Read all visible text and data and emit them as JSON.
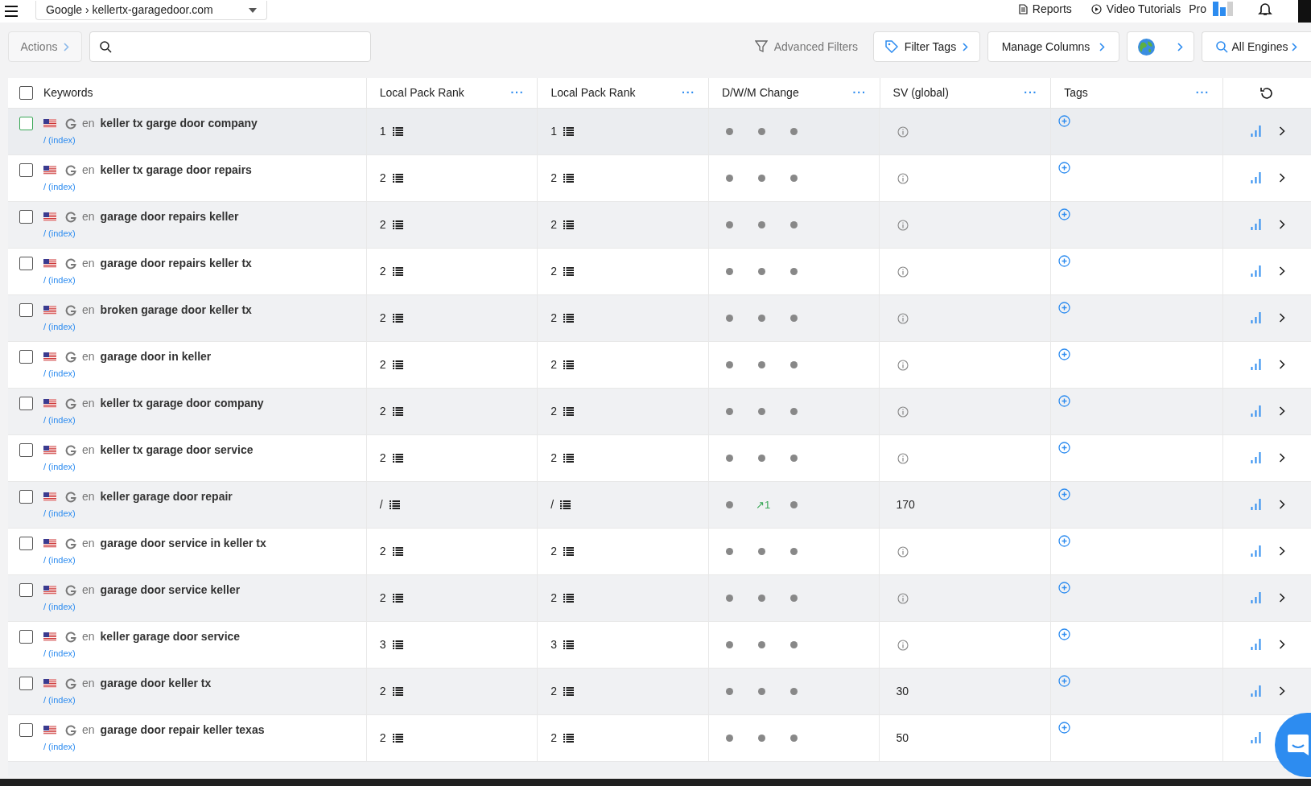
{
  "topbar": {
    "project": "Google › kellertx-garagedoor.com",
    "links": [
      "Reports",
      "Video Tutorials"
    ],
    "plan": "Pro"
  },
  "toolbar": {
    "actions": "Actions",
    "advanced_filters": "Advanced Filters",
    "filter_tags": "Filter Tags",
    "manage_columns": "Manage Columns",
    "engines": "All Engines"
  },
  "table": {
    "select_all_checked": false,
    "columns": [
      {
        "label": "Keywords"
      },
      {
        "label": "Local Pack Rank",
        "menu": "···"
      },
      {
        "label": "Local Pack Rank",
        "menu": "···"
      },
      {
        "label": "D/W/M Change",
        "menu": "···"
      },
      {
        "label": "SV (global)",
        "menu": "···"
      },
      {
        "label": "Tags",
        "menu": "···"
      }
    ],
    "rows": [
      {
        "checked": false,
        "focused": true,
        "lang": "en",
        "keyword": "keller tx garge door company",
        "url": "/ (index)",
        "rank_1": "1",
        "rank_2": "1",
        "changes": [
          {
            "kind": "none"
          },
          {
            "kind": "none"
          },
          {
            "kind": "none"
          }
        ]
      },
      {
        "checked": false,
        "focused": false,
        "lang": "en",
        "keyword": "keller tx garage door repairs",
        "url": "/ (index)",
        "rank_1": "2",
        "rank_2": "2",
        "changes": [
          {
            "kind": "none"
          },
          {
            "kind": "none"
          },
          {
            "kind": "none"
          }
        ]
      },
      {
        "checked": false,
        "focused": false,
        "lang": "en",
        "keyword": "garage door repairs keller",
        "url": "/ (index)",
        "rank_1": "2",
        "rank_2": "2",
        "changes": [
          {
            "kind": "none"
          },
          {
            "kind": "none"
          },
          {
            "kind": "none"
          }
        ]
      },
      {
        "checked": false,
        "focused": false,
        "lang": "en",
        "keyword": "garage door repairs keller tx",
        "url": "/ (index)",
        "rank_1": "2",
        "rank_2": "2",
        "changes": [
          {
            "kind": "none"
          },
          {
            "kind": "none"
          },
          {
            "kind": "none"
          }
        ]
      },
      {
        "checked": false,
        "focused": false,
        "lang": "en",
        "keyword": "broken garage door keller tx",
        "url": "/ (index)",
        "rank_1": "2",
        "rank_2": "2",
        "changes": [
          {
            "kind": "none"
          },
          {
            "kind": "none"
          },
          {
            "kind": "none"
          }
        ]
      },
      {
        "checked": false,
        "focused": false,
        "lang": "en",
        "keyword": "garage door in keller",
        "url": "/ (index)",
        "rank_1": "2",
        "rank_2": "2",
        "changes": [
          {
            "kind": "none"
          },
          {
            "kind": "none"
          },
          {
            "kind": "none"
          }
        ]
      },
      {
        "checked": false,
        "focused": false,
        "lang": "en",
        "keyword": "keller tx garage door company",
        "url": "/ (index)",
        "rank_1": "2",
        "rank_2": "2",
        "changes": [
          {
            "kind": "none"
          },
          {
            "kind": "none"
          },
          {
            "kind": "none"
          }
        ]
      },
      {
        "checked": false,
        "focused": false,
        "lang": "en",
        "keyword": "keller tx garage door service",
        "url": "/ (index)",
        "rank_1": "2",
        "rank_2": "2",
        "changes": [
          {
            "kind": "none"
          },
          {
            "kind": "none"
          },
          {
            "kind": "none"
          }
        ]
      },
      {
        "checked": false,
        "focused": false,
        "lang": "en",
        "keyword": "keller garage door repair",
        "url": "/ (index)",
        "rank_1": "/",
        "rank_2": "/",
        "changes": [
          {
            "kind": "none"
          },
          {
            "kind": "up",
            "value": "↗1"
          },
          {
            "kind": "none"
          }
        ],
        "sv": "170"
      },
      {
        "checked": false,
        "focused": false,
        "lang": "en",
        "keyword": "garage door service in keller tx",
        "url": "/ (index)",
        "rank_1": "2",
        "rank_2": "2",
        "changes": [
          {
            "kind": "none"
          },
          {
            "kind": "none"
          },
          {
            "kind": "none"
          }
        ]
      },
      {
        "checked": false,
        "focused": false,
        "lang": "en",
        "keyword": "garage door service keller",
        "url": "/ (index)",
        "rank_1": "2",
        "rank_2": "2",
        "changes": [
          {
            "kind": "none"
          },
          {
            "kind": "none"
          },
          {
            "kind": "none"
          }
        ]
      },
      {
        "checked": false,
        "focused": false,
        "lang": "en",
        "keyword": "keller garage door service",
        "url": "/ (index)",
        "rank_1": "3",
        "rank_2": "3",
        "changes": [
          {
            "kind": "none"
          },
          {
            "kind": "none"
          },
          {
            "kind": "none"
          }
        ]
      },
      {
        "checked": false,
        "focused": false,
        "lang": "en",
        "keyword": "garage door keller tx",
        "url": "/ (index)",
        "rank_1": "2",
        "rank_2": "2",
        "changes": [
          {
            "kind": "none"
          },
          {
            "kind": "none"
          },
          {
            "kind": "none"
          }
        ],
        "sv": "30"
      },
      {
        "checked": false,
        "focused": false,
        "lang": "en",
        "keyword": "garage door repair keller texas",
        "url": "/ (index)",
        "rank_1": "2",
        "rank_2": "2",
        "changes": [
          {
            "kind": "none"
          },
          {
            "kind": "none"
          },
          {
            "kind": "none"
          }
        ],
        "sv": "50"
      }
    ]
  }
}
